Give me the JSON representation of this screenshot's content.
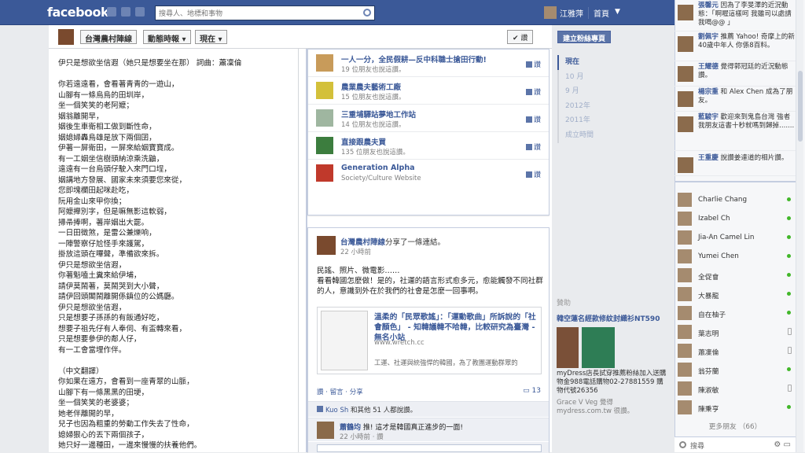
{
  "topbar": {
    "logo": "facebook",
    "search_placeholder": "搜尋人、地標和事物",
    "user": "江雅萍",
    "home": "首頁"
  },
  "page_header": {
    "name": "台灣農村陣線",
    "feed_btn": "動態時報",
    "now_btn": "現在",
    "like_btn": "讚"
  },
  "poem": "伊只是想欲坐信遐（她只是想要坐在那） 詞曲：蕭凜倫\n\n你若遠遠看，會看著青青的一遊山，\n山腳有一條烏烏的田圳岸，\n坐一個笑笑的老阿嬤；\n姻翁離開早，\n姻後生車衛相工做到斷性命，\n姻媳婦轟烏雄是放下兩個囝，\n伊著一屏衛田，一屏來給姻寶寶成。\n有一工姻坐信樹頭納涼乘洗鼬，\n遠遠有一台烏頭仔駛入來門口埕，\n姻講地方發展、國家未來須要您來從，\n您即塊欄田起咪赴吃，\n阮用金山來甲你換；\n阿嬤攑別字，但是嘛無影這軟弱，\n掃帚捧啊，著岸姻出大罷。\n一日田徵煞，是雷公兼爍响，\n一陣警察仔尬怪手來護駕，\n掛放這頭在嗶聲，準備欲來拆。\n伊只是想欲坐信遐，\n你著魁嗑土糞來給伊埔，\n請伊莫鬧著，莫鬧哭到大小聲，\n請伊回頭閣鬧離開係鎮位的公媽廳。\n伊只是想欲坐信遐，\n只是想要子孫孫的有飯通好吃，\n想要子祖先仔有人奉伺、有盃轉來看，\n只是想要參伊的鄰人仔，\n有一工會當埋作伴。\n\n（中文翻譯）\n你如果在遠方，會看到一座青翠的山脈，\n山腳下有一條黑黑的田埂，\n坐一個笑笑的老婆婆；\n她老伴離開的早，\n兒子也因為粗重的勞動工作失去了性命，\n媳婦狠心的丟下兩個孩子，\n她只好一邊種田，一邊來慢慢的扶養他們。",
  "liked_pages": [
    {
      "title": "一人一分，全民假耕—反中科職士搶田行動!",
      "sub": "19 位朋友也說這讚。",
      "like": "讚"
    },
    {
      "title": "農業農夫藝術工廠",
      "sub": "15 位朋友也說這讚。",
      "like": "讚"
    },
    {
      "title": "三重埔驛站夢地工作站",
      "sub": "14 位朋友也說這讚。",
      "like": "讚"
    },
    {
      "title": "直接跟農夫買",
      "sub": "135 位朋友也說這讚。",
      "like": "讚"
    },
    {
      "title": "Generation Alpha",
      "sub": "Society/Culture Website",
      "like": "讚"
    }
  ],
  "post": {
    "author": "台灣農村陣線",
    "action": "分享了一條連結。",
    "time": "22 小時前",
    "body": "民謠、照片、微電影……\n看看韓國怎麼做！是的，社運的語言形式愈多元，愈能觸發不同社群的人，意識到外在於我們的社會是怎麼一回事啊。",
    "link_title": "溫柔的「民眾歌謠」：「運動歌曲」所訴說的「社會顏色」 - 知韓議韓不哈韓，比較研究為臺灣 - 無名小站",
    "link_url": "www.wretch.cc",
    "link_desc": "工運、社運與統強悍的韓國，為了教團運動群眾的",
    "actions": "讚 · 留言 · 分享",
    "comment_count": "13",
    "likes_line_name": "Kuo Sh",
    "likes_line_rest": "和其他 51 人都說讚。",
    "comment_author": "蕭鶴均",
    "comment_text": "推! 這才是韓國真正進步的一面!",
    "comment_time": "22 小時前 · 讚"
  },
  "timeline_btn": "建立粉絲專頁",
  "timeline_nav": [
    "現在",
    "10 月",
    "9 月",
    "2012年",
    "2011年",
    "成立時間"
  ],
  "sponsor": {
    "head": "贊助",
    "title": "韓空蓮名經款修紋封織衫NT590",
    "desc": "myDress店長試穿推薦粉絲加入送購物金988電話購物02-27881559 購物代號26356",
    "footer": "Grace V Veg 覺得 mydress.com.tw 很讚。"
  },
  "ticker": [
    {
      "name": "張馨元",
      "text": "因為了李旻澤的近況動態：「啊喔這樣呵 我雖司以處請我喝@@ 」"
    },
    {
      "name": "劉佩宇",
      "text": "推薦 Yahoo! 奇摩上的新40歲中年人 你係8百料。"
    },
    {
      "name": "王耀德",
      "text": "覺得郭冠廷的近況動態讚。"
    },
    {
      "name": "楊宗重",
      "text": "和 Alex Chen 成為了朋友。"
    },
    {
      "name": "藍駿宇",
      "text": "歡迎來到鬼島台灣 強者我朋友這書十秒就嗎到歸掉......."
    },
    {
      "name": "王重慶",
      "text": "說讚姜達道的相片讚。"
    }
  ],
  "friends": [
    {
      "name": "Charlie Chang",
      "status": "online"
    },
    {
      "name": "Izabel Ch",
      "status": "online"
    },
    {
      "name": "Jia-An Camel Lin",
      "status": "online"
    },
    {
      "name": "Yumei Chen",
      "status": "online"
    },
    {
      "name": "全促會",
      "status": "online"
    },
    {
      "name": "大暴龍",
      "status": "online"
    },
    {
      "name": "自在柚子",
      "status": "online"
    },
    {
      "name": "葉志明",
      "status": "mobile"
    },
    {
      "name": "蕭凜倫",
      "status": "mobile"
    },
    {
      "name": "翁芬蘭",
      "status": "online"
    },
    {
      "name": "陳淑敏",
      "status": "mobile"
    },
    {
      "name": "陳秉亨",
      "status": "online"
    }
  ],
  "more_friends": "更多朋友 （66）",
  "chat_search": "搜尋"
}
